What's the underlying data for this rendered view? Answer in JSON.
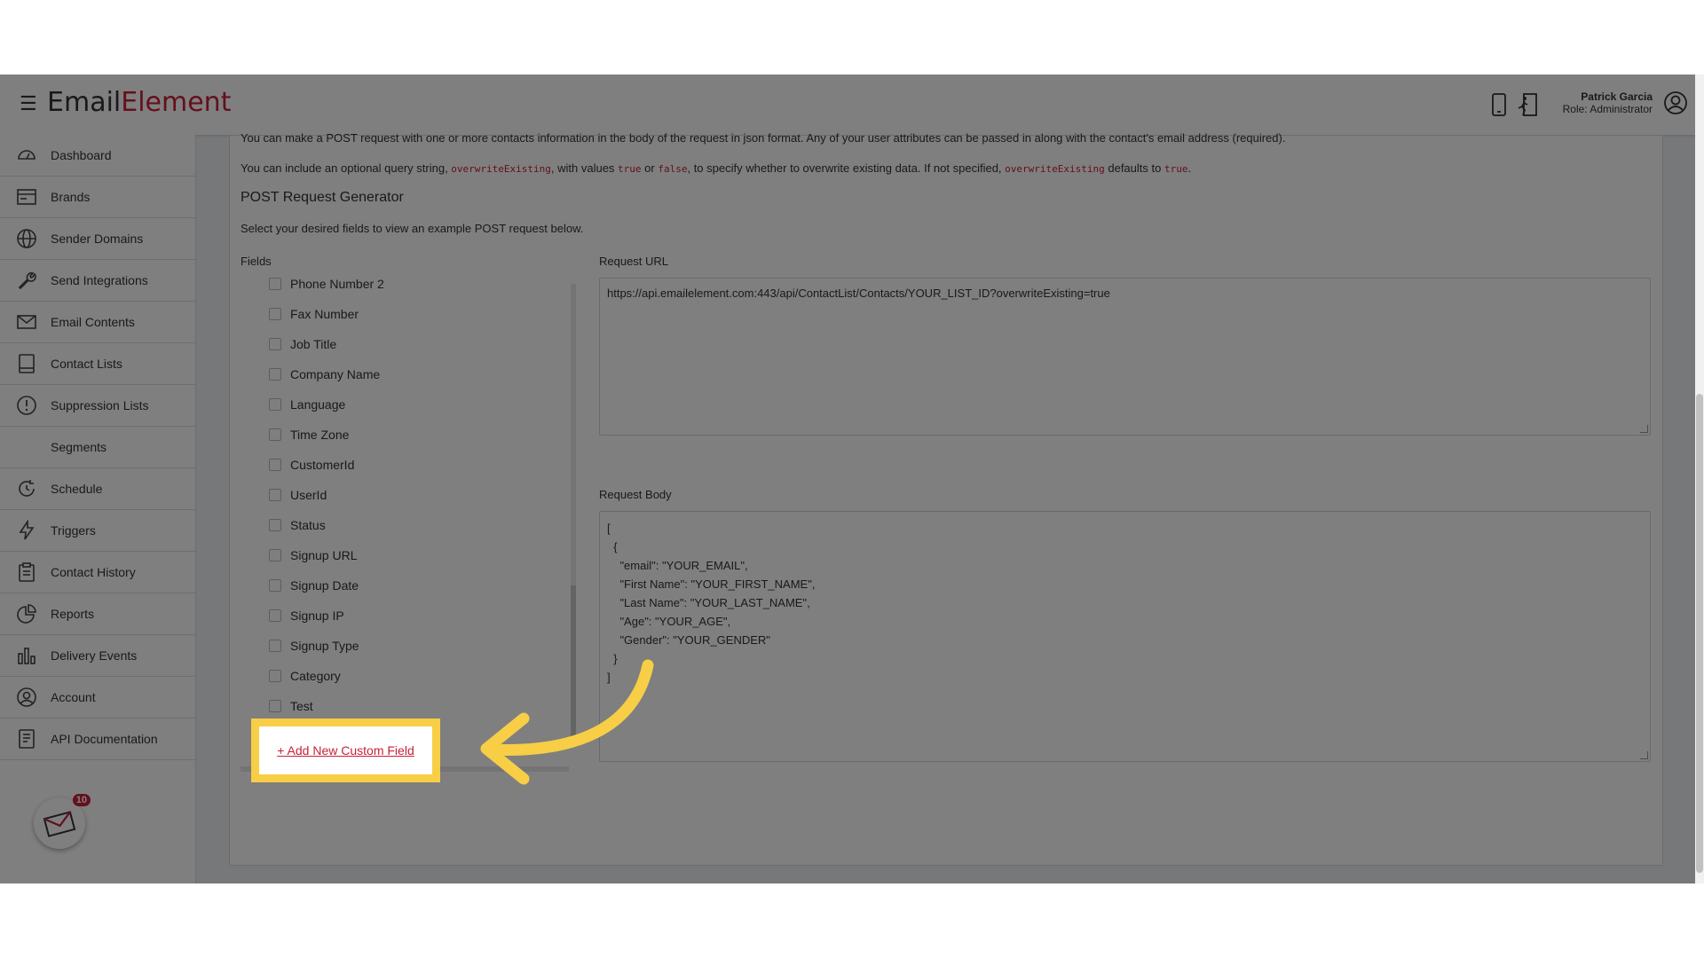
{
  "header": {
    "logo_part1": "Em",
    "logo_part2": "ail",
    "logo_part3": "Element",
    "user_name": "Patrick Garcia",
    "user_role": "Role: Administrator"
  },
  "sidebar": {
    "items": [
      {
        "label": "Dashboard",
        "icon": "dashboard-icon"
      },
      {
        "label": "Brands",
        "icon": "brands-icon"
      },
      {
        "label": "Sender Domains",
        "icon": "globe-icon"
      },
      {
        "label": "Send Integrations",
        "icon": "wrench-icon"
      },
      {
        "label": "Email Contents",
        "icon": "envelope-icon"
      },
      {
        "label": "Contact Lists",
        "icon": "book-icon"
      },
      {
        "label": "Suppression Lists",
        "icon": "alert-icon"
      },
      {
        "label": "Segments",
        "icon": ""
      },
      {
        "label": "Schedule",
        "icon": "clock-icon"
      },
      {
        "label": "Triggers",
        "icon": "lightning-icon"
      },
      {
        "label": "Contact History",
        "icon": "clipboard-icon"
      },
      {
        "label": "Reports",
        "icon": "pie-chart-icon"
      },
      {
        "label": "Delivery Events",
        "icon": "bar-chart-icon"
      },
      {
        "label": "Account",
        "icon": "user-icon"
      },
      {
        "label": "API Documentation",
        "icon": "document-icon"
      }
    ],
    "notification_count": "10"
  },
  "main": {
    "intro_text": "You can make a POST request with one or more contacts information in the body of the request in json format. Any of your user attributes can be passed in along with the contact's email address (required).",
    "query_text_1": "You can include an optional query string, ",
    "query_code_1": "overwriteExisting",
    "query_text_2": ", with values ",
    "query_code_2": "true",
    "query_text_3": " or ",
    "query_code_3": "false",
    "query_text_4": ", to specify whether to overwrite existing data. If not specified, ",
    "query_code_4": "overwriteExisting",
    "query_text_5": " defaults to ",
    "query_code_5": "true",
    "query_text_6": ".",
    "generator_title": "POST Request Generator",
    "generator_subtitle": "Select your desired fields to view an example POST request below.",
    "fields_label": "Fields",
    "fields": [
      "Phone Number 2",
      "Fax Number",
      "Job Title",
      "Company Name",
      "Language",
      "Time Zone",
      "CustomerId",
      "UserId",
      "Status",
      "Signup URL",
      "Signup Date",
      "Signup IP",
      "Signup Type",
      "Category",
      "Test"
    ],
    "add_custom_field": "+ Add New Custom Field",
    "request_url_label": "Request URL",
    "request_url": "https://api.emailelement.com:443/api/ContactList/Contacts/YOUR_LIST_ID?overwriteExisting=true",
    "request_body_label": "Request Body",
    "request_body": "[\n  {\n    \"email\": \"YOUR_EMAIL\",\n    \"First Name\": \"YOUR_FIRST_NAME\",\n    \"Last Name\": \"YOUR_LAST_NAME\",\n    \"Age\": \"YOUR_AGE\",\n    \"Gender\": \"YOUR_GENDER\"\n  }\n]"
  },
  "colors": {
    "brand_red": "#c8203a",
    "highlight_yellow": "#f7ce46"
  }
}
